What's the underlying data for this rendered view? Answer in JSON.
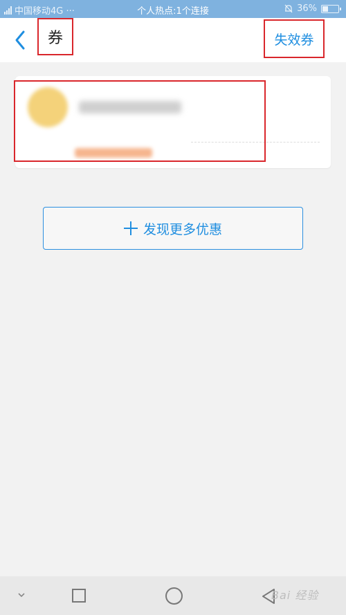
{
  "status_bar": {
    "carrier": "中国移动4G ···",
    "center": "个人热点:1个连接",
    "battery_text": "36%",
    "battery_level": 0.36,
    "icons": [
      "signal-icon",
      "alarm-icon",
      "battery-icon"
    ]
  },
  "header": {
    "back_icon": "chevron-left-icon",
    "title": "券",
    "expired_label": "失效券"
  },
  "discover": {
    "icon": "plus-icon",
    "label": "发现更多优惠"
  },
  "nav_bar": {
    "icons": [
      "chevron-down-icon",
      "square-icon",
      "circle-icon",
      "back-triangle-icon"
    ],
    "watermark": "Bai 经验"
  },
  "colors": {
    "accent": "#1f8ee0",
    "status_bar": "#7fb2df",
    "annotation": "#d9262b",
    "background": "#f2f2f2"
  }
}
